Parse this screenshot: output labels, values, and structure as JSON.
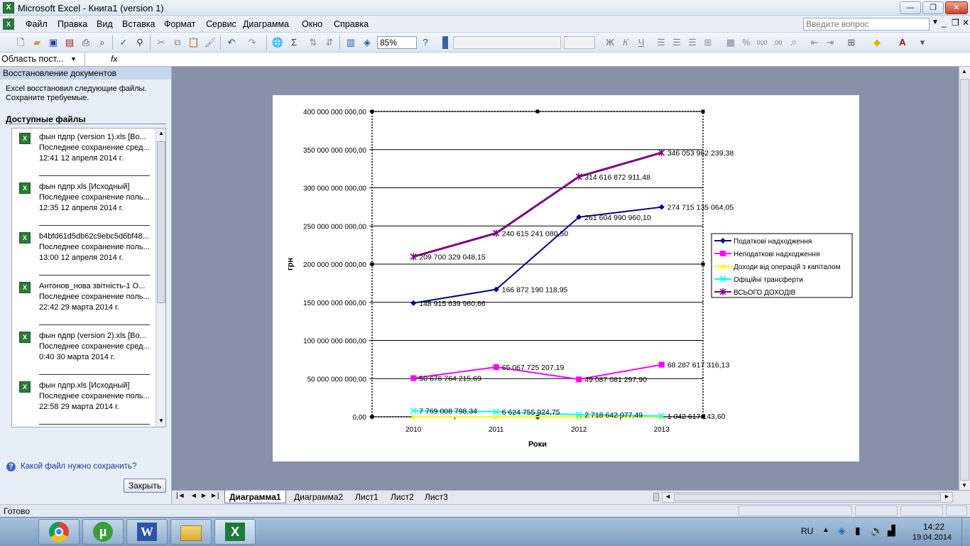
{
  "window": {
    "title": "Microsoft Excel - Книга1 (version 1)",
    "app_icon": "excel-icon"
  },
  "menu": {
    "items": [
      "Файл",
      "Правка",
      "Вид",
      "Вставка",
      "Формат",
      "Сервис",
      "Диаграмма",
      "Окно",
      "Справка"
    ],
    "help_placeholder": "Введите вопрос"
  },
  "toolbar": {
    "zoom": "85%"
  },
  "formula_bar": {
    "name_box": "Область пост...",
    "fx_label": "fx",
    "value": ""
  },
  "task_pane": {
    "title": "Восстановление документов",
    "message": "Excel восстановил следующие файлы. Сохраните требуемые.",
    "available_heading": "Доступные файлы",
    "files": [
      {
        "name": "фын пдпр (version 1).xls  [Во...",
        "line2": "Последнее сохранение сред...",
        "line3": "12:41 12 апреля 2014 г."
      },
      {
        "name": "фын пдпр.xls  [Исходный]",
        "line2": "Последнее сохранение поль...",
        "line3": "12:35 12 апреля 2014 г."
      },
      {
        "name": "b4bfd61d5db62c9ebc5d6bf48...",
        "line2": "Последнее сохранение поль...",
        "line3": "13:00 12 апреля 2014 г."
      },
      {
        "name": "Антонов_нова звітність-1 О...",
        "line2": "Последнее сохранение поль...",
        "line3": "22:42 29 марта 2014 г."
      },
      {
        "name": "фын пдпр (version 2).xls  [Во...",
        "line2": "Последнее сохранение сред...",
        "line3": "0:40 30 марта 2014 г."
      },
      {
        "name": "фын пдпр.xls  [Исходный]",
        "line2": "Последнее сохранение поль...",
        "line3": "22:58 29 марта 2014 г."
      }
    ],
    "help_link": "Какой файл нужно сохранить?",
    "close_button": "Закрыть"
  },
  "sheet_tabs": [
    "Диаграмма1",
    "Диаграмма2",
    "Лист1",
    "Лист2",
    "Лист3"
  ],
  "active_tab": "Диаграмма1",
  "status": {
    "text": "Готово"
  },
  "taskbar": {
    "lang": "RU",
    "time": "14:22",
    "date": "19.04.2014",
    "apps": [
      "chrome-icon",
      "utorrent-icon",
      "word-icon",
      "explorer-icon",
      "excel-icon"
    ]
  },
  "chart_data": {
    "type": "line",
    "xlabel": "Роки",
    "ylabel": "грн",
    "ylim": [
      0,
      400000000000
    ],
    "ytick_labels": [
      "0,00",
      "50 000 000 000,00",
      "100 000 000 000,00",
      "150 000 000 000,00",
      "200 000 000 000,00",
      "250 000 000 000,00",
      "300 000 000 000,00",
      "350 000 000 000,00",
      "400 000 000 000,00"
    ],
    "categories": [
      "2010",
      "2011",
      "2012",
      "2013"
    ],
    "legend_position": "right",
    "grid": true,
    "series": [
      {
        "name": "Податкові надходження",
        "color": "#000080",
        "marker": "diamond",
        "values": [
          148915639960.66,
          166872190118.95,
          261604990960.1,
          274715135064.05
        ],
        "labels": [
          "148 915 639 960,66",
          "166 872 190 118,95",
          "261 604 990 960,10",
          "274 715 135 064,05"
        ]
      },
      {
        "name": "Неподаткові надходження",
        "color": "#ff00ff",
        "marker": "square",
        "values": [
          50676764215.69,
          65067725207.19,
          49087081297.9,
          68287617316.13
        ],
        "labels": [
          "50 676 764 215,69",
          "65 067 725 207,19",
          "49 087 081 297,90",
          "68 287 617 316,13"
        ]
      },
      {
        "name": "Доходи від операцій з капіталом",
        "color": "#ffff00",
        "marker": "triangle",
        "values": [
          0,
          0,
          0,
          0
        ],
        "labels": []
      },
      {
        "name": "Офіційні трансферти",
        "color": "#00ffff",
        "marker": "x",
        "values": [
          7769008798.34,
          6624755924.75,
          2718642077.49,
          1042617143.6
        ],
        "labels": [
          "7 769 008 798,34",
          "6 624 755 924,75",
          "2 718 642 077,49",
          "1 042 617 143,60"
        ]
      },
      {
        "name": "ВСЬОГО ДОХОДІВ",
        "color": "#800080",
        "marker": "star",
        "values": [
          209700329048.15,
          240615241080.5,
          314616872911.48,
          346053962239.38
        ],
        "labels": [
          "209 700 329 048,15",
          "240 615 241 080,50",
          "314 616 872 911,48",
          "346 053 962 239,38"
        ]
      }
    ]
  }
}
